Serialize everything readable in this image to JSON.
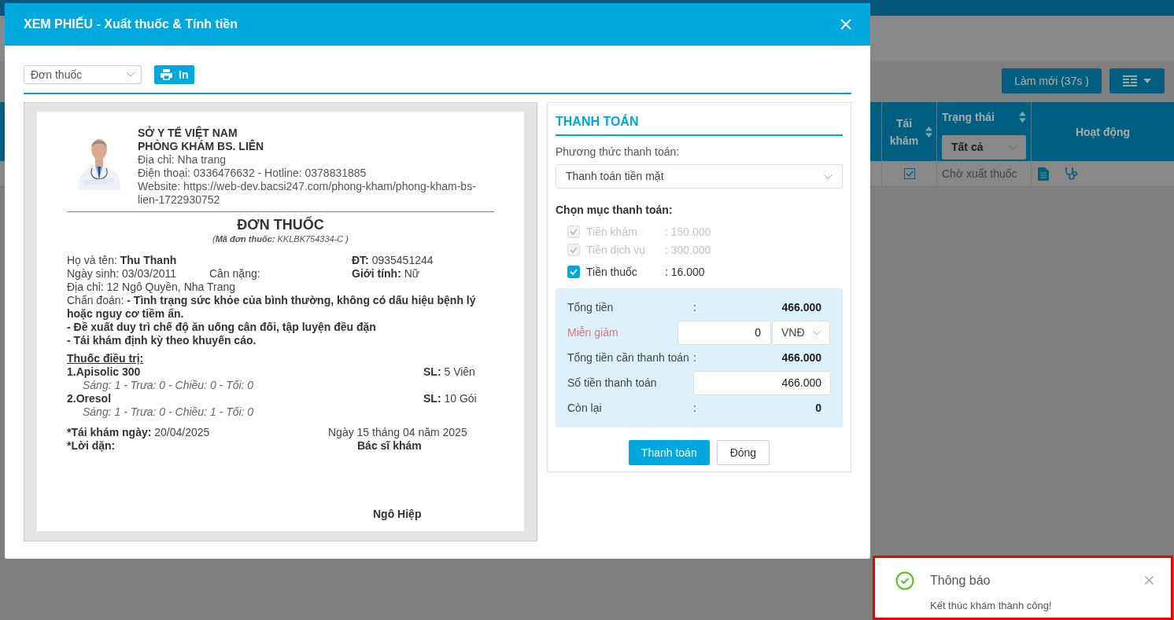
{
  "background": {
    "toolbar": {
      "refresh_button": "Làm mới (37s )"
    },
    "table": {
      "columns": [
        {
          "label": "Tái khám",
          "sortable": true
        },
        {
          "label": "Trạng thái",
          "sortable": true,
          "filter": "Tất cả"
        },
        {
          "label": "Hoạt động",
          "sortable": false
        }
      ],
      "rows": [
        {
          "follow_up": true,
          "status": "Chờ xuất thuốc"
        }
      ]
    }
  },
  "modal": {
    "title": "XEM PHIẾU - Xuất thuốc & Tính tiền",
    "toolbar": {
      "document_select": "Đơn thuốc",
      "print_button": "In"
    },
    "prescription": {
      "header": [
        "SỞ Y TẾ VIỆT NAM",
        "PHÒNG KHÁM BS. LIÊN"
      ],
      "contact": [
        "Địa chỉ: Nha trang",
        "Điện thoại: 0336476632 - Hotline: 0378831885",
        "Website: https://web-dev.bacsi247.com/phong-kham/phong-kham-bs-lien-1722930752"
      ],
      "title": "ĐƠN THUỐC",
      "code_line": "(**Mã đơn thuốc:** KKLBK754334-C )",
      "patient": {
        "name_label": "Họ và tên:",
        "name": "Thu Thanh",
        "phone_label": "ĐT:",
        "phone": "0935451244",
        "dob": "Ngày sinh: 03/03/2011",
        "weight": "Cân nặng:",
        "gender_label": "Giới tính:",
        "gender": "Nữ",
        "address": "Địa chỉ: 12 Ngô Quyền, Nha Trang"
      },
      "diagnosis_label": "Chẩn đoán:",
      "diagnosis": [
        "- Tình trạng sức khỏe của bình thường, không có dấu hiệu bệnh lý hoặc nguy cơ tiềm ẩn.",
        "- Đề xuất duy trì chế độ ăn uống cân đối, tập luyện đều đặn",
        "- Tái khám định kỳ theo khuyến cáo."
      ],
      "medicines_heading": "Thuốc điều trị:",
      "medicines": [
        {
          "name": "1.Apisolic 300",
          "qty_label": "SL:",
          "qty": "5 Viên",
          "dosage": "Sáng: 1 - Trưa: 0 - Chiều: 0 - Tối: 0"
        },
        {
          "name": "2.Oresol",
          "qty_label": "SL:",
          "qty": "10 Gói",
          "dosage": "Sáng: 1 - Trưa: 0 - Chiều: 1 - Tối: 0"
        }
      ],
      "followup_label": "*Tái khám ngày:",
      "followup": "20/04/2025",
      "date_line": "Ngày 15 tháng 04 năm 2025",
      "advice_label": "*Lời dặn:",
      "doctor_title": "Bác sĩ khám",
      "doctor_name": "Ngô Hiệp"
    },
    "payment": {
      "title": "THANH TOÁN",
      "method_label": "Phương thức thanh toán:",
      "method": "Thanh toán tiền mặt",
      "items_label": "Chọn mục thanh toán:",
      "items": [
        {
          "label": "Tiền khám",
          "amount": ": 150.000",
          "checked": true,
          "disabled": true
        },
        {
          "label": "Tiền dịch vụ",
          "amount": ": 300.000",
          "checked": true,
          "disabled": true
        },
        {
          "label": "Tiền thuốc",
          "amount": ": 16.000",
          "checked": true,
          "disabled": false
        }
      ],
      "summary": [
        {
          "kind": "value",
          "label": "Tổng tiền",
          "sep": ":",
          "value": "466.000"
        },
        {
          "kind": "discount",
          "label": "Miễn giảm",
          "value": "0",
          "unit": "VNĐ"
        },
        {
          "kind": "value",
          "label": "Tổng tiền cần thanh toán",
          "sep": ":",
          "value": "466.000"
        },
        {
          "kind": "input",
          "label": "Số tiền thanh toán",
          "value": "466.000"
        },
        {
          "kind": "value",
          "label": "Còn lại",
          "sep": ":",
          "value": "0"
        }
      ],
      "buttons": [
        {
          "label": "Thanh toán",
          "primary": true
        },
        {
          "label": "Đóng",
          "primary": false
        }
      ]
    }
  },
  "toast": {
    "title": "Thông báo",
    "message": "Kết thúc khám thành công!"
  }
}
